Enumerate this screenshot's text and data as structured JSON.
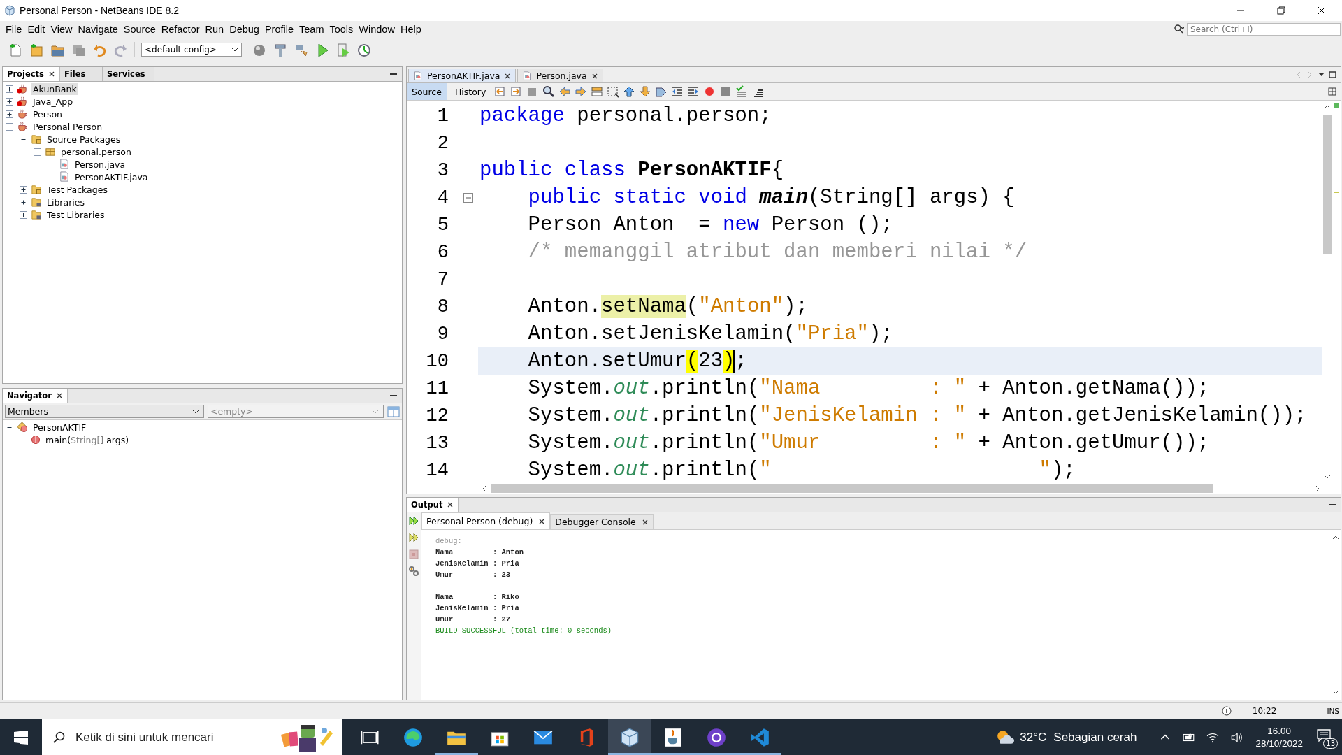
{
  "window": {
    "title": "Personal Person - NetBeans IDE 8.2"
  },
  "menu": [
    "File",
    "Edit",
    "View",
    "Navigate",
    "Source",
    "Refactor",
    "Run",
    "Debug",
    "Profile",
    "Team",
    "Tools",
    "Window",
    "Help"
  ],
  "toolbar": {
    "config": "<default config>"
  },
  "search": {
    "placeholder": "Search (Ctrl+I)"
  },
  "projects": {
    "tabs": [
      {
        "label": "Projects",
        "selected": true
      },
      {
        "label": "Files",
        "selected": false
      },
      {
        "label": "Services",
        "selected": false
      }
    ],
    "tree": [
      {
        "label": "AkunBank",
        "kind": "project_error",
        "selected": true,
        "expanded": false
      },
      {
        "label": "Java_App",
        "kind": "project_error",
        "selected": false,
        "expanded": false
      },
      {
        "label": "Person",
        "kind": "project",
        "selected": false,
        "expanded": false
      },
      {
        "label": "Personal Person",
        "kind": "project",
        "selected": false,
        "expanded": true,
        "children": [
          {
            "label": "Source Packages",
            "kind": "sources",
            "selected": false,
            "expanded": true,
            "children": [
              {
                "label": "personal.person",
                "kind": "package",
                "selected": false,
                "expanded": true,
                "children": [
                  {
                    "label": "Person.java",
                    "kind": "file",
                    "selected": false
                  },
                  {
                    "label": "PersonAKTIF.java",
                    "kind": "file",
                    "selected": false
                  }
                ]
              }
            ]
          },
          {
            "label": "Test Packages",
            "kind": "sources",
            "selected": false,
            "expanded": false
          },
          {
            "label": "Libraries",
            "kind": "library",
            "selected": false,
            "expanded": false
          },
          {
            "label": "Test Libraries",
            "kind": "library",
            "selected": false,
            "expanded": false
          }
        ]
      }
    ]
  },
  "navigator": {
    "tabs": [
      {
        "label": "Navigator",
        "selected": true
      }
    ],
    "filter": "Members",
    "scope": "<empty>",
    "class": {
      "label": "PersonAKTIF",
      "expanded": true
    },
    "members": [
      {
        "parts": [
          {
            "text": "main(",
            "kind": "name"
          },
          {
            "text": "String[]",
            "kind": "type"
          },
          {
            "text": " args)",
            "kind": "name"
          }
        ]
      }
    ]
  },
  "editor": {
    "tabs": [
      {
        "label": "PersonAKTIF.java",
        "selected": true
      },
      {
        "label": "Person.java",
        "selected": false
      }
    ],
    "views": [
      {
        "label": "Source",
        "selected": true
      },
      {
        "label": "History",
        "selected": false
      }
    ],
    "lines": [
      {
        "number": "1",
        "current": false,
        "fold": false,
        "tokens": [
          {
            "text": "package",
            "kind": "keyword"
          },
          {
            "text": " personal.person;",
            "kind": "plain"
          }
        ]
      },
      {
        "number": "2"
      },
      {
        "number": "3",
        "current": false,
        "fold": false,
        "tokens": [
          {
            "text": "public class",
            "kind": "keyword"
          },
          {
            "text": " PersonAKTIF",
            "kind": "classname"
          },
          {
            "text": "{",
            "kind": "plain"
          }
        ]
      },
      {
        "number": "4",
        "current": false,
        "fold": true,
        "tokens": [
          {
            "text": "    public static void",
            "kind": "keyword"
          },
          {
            "text": " main",
            "kind": "methoddecl"
          },
          {
            "text": "(String[] args) {",
            "kind": "plain"
          }
        ]
      },
      {
        "number": "5",
        "current": false,
        "fold": false,
        "tokens": [
          {
            "text": "    Person Anton  = ",
            "kind": "plain"
          },
          {
            "text": "new",
            "kind": "keyword"
          },
          {
            "text": " Person ();",
            "kind": "plain"
          }
        ]
      },
      {
        "number": "6",
        "current": false,
        "fold": false,
        "tokens": [
          {
            "text": "    /* memanggil atribut dan memberi nilai */",
            "kind": "comment"
          }
        ]
      },
      {
        "number": "7"
      },
      {
        "number": "8",
        "current": false,
        "fold": false,
        "tokens": [
          {
            "text": "    Anton.",
            "kind": "plain"
          },
          {
            "text": "setNama",
            "kind": "occurrence"
          },
          {
            "text": "(",
            "kind": "plain"
          },
          {
            "text": "\"Anton\"",
            "kind": "string"
          },
          {
            "text": ");",
            "kind": "plain"
          }
        ]
      },
      {
        "number": "9",
        "current": false,
        "fold": false,
        "tokens": [
          {
            "text": "    Anton.setJenisKelamin(",
            "kind": "plain"
          },
          {
            "text": "\"Pria\"",
            "kind": "string"
          },
          {
            "text": ");",
            "kind": "plain"
          }
        ]
      },
      {
        "number": "10",
        "current": true,
        "fold": false,
        "tokens": [
          {
            "text": "    Anton.setUmur",
            "kind": "plain"
          },
          {
            "text": "(",
            "kind": "bracket"
          },
          {
            "text": "23",
            "kind": "plain"
          },
          {
            "text": ")",
            "kind": "bracket",
            "caret": true
          },
          {
            "text": ";",
            "kind": "plain"
          }
        ]
      },
      {
        "number": "11",
        "current": false,
        "fold": false,
        "tokens": [
          {
            "text": "    System.",
            "kind": "plain"
          },
          {
            "text": "out",
            "kind": "field"
          },
          {
            "text": ".println(",
            "kind": "plain"
          },
          {
            "text": "\"Nama         : \"",
            "kind": "string"
          },
          {
            "text": " + Anton.getNama());",
            "kind": "plain"
          }
        ]
      },
      {
        "number": "12",
        "current": false,
        "fold": false,
        "tokens": [
          {
            "text": "    System.",
            "kind": "plain"
          },
          {
            "text": "out",
            "kind": "field"
          },
          {
            "text": ".println(",
            "kind": "plain"
          },
          {
            "text": "\"JenisKelamin : \"",
            "kind": "string"
          },
          {
            "text": " + Anton.getJenisKelamin());",
            "kind": "plain"
          }
        ]
      },
      {
        "number": "13",
        "current": false,
        "fold": false,
        "tokens": [
          {
            "text": "    System.",
            "kind": "plain"
          },
          {
            "text": "out",
            "kind": "field"
          },
          {
            "text": ".println(",
            "kind": "plain"
          },
          {
            "text": "\"Umur         : \"",
            "kind": "string"
          },
          {
            "text": " + Anton.getUmur());",
            "kind": "plain"
          }
        ]
      },
      {
        "number": "14",
        "current": false,
        "fold": false,
        "tokens": [
          {
            "text": "    System.",
            "kind": "plain"
          },
          {
            "text": "out",
            "kind": "field"
          },
          {
            "text": ".println(",
            "kind": "plain"
          },
          {
            "text": "\"                      \"",
            "kind": "string"
          },
          {
            "text": ");",
            "kind": "plain"
          }
        ]
      }
    ]
  },
  "output": {
    "tabs": [
      {
        "label": "Output",
        "selected": true
      }
    ],
    "subtabs": [
      {
        "label": "Personal Person (debug)",
        "selected": true
      },
      {
        "label": "Debugger Console",
        "selected": false
      }
    ],
    "blocks": [
      {
        "lines": [
          {
            "text": "debug:",
            "kind": "info"
          },
          {
            "text": "Nama         : Anton",
            "kind": "normal"
          },
          {
            "text": "JenisKelamin : Pria",
            "kind": "normal"
          },
          {
            "text": "Umur         : 23",
            "kind": "normal"
          }
        ]
      },
      {
        "lines": [
          {
            "text": "Nama         : Riko",
            "kind": "normal"
          },
          {
            "text": "JenisKelamin : Pria",
            "kind": "normal"
          },
          {
            "text": "Umur         : 27",
            "kind": "normal"
          },
          {
            "text": "BUILD SUCCESSFUL (total time: 0 seconds)",
            "kind": "success"
          }
        ]
      }
    ]
  },
  "status_bar": {
    "position": "10:22",
    "mode": "INS"
  },
  "taskbar": {
    "search_placeholder": "Ketik di sini untuk mencari",
    "apps": [
      {
        "kind": "taskview",
        "selected": false,
        "running": false
      },
      {
        "kind": "edge",
        "selected": false,
        "running": false
      },
      {
        "kind": "explorer",
        "selected": false,
        "running": true
      },
      {
        "kind": "store",
        "selected": false,
        "running": false
      },
      {
        "kind": "mail",
        "selected": false,
        "running": false
      },
      {
        "kind": "office",
        "selected": false,
        "running": false
      },
      {
        "kind": "netbeans",
        "selected": true,
        "running": true
      },
      {
        "kind": "java",
        "selected": false,
        "running": true
      },
      {
        "kind": "github",
        "selected": false,
        "running": true
      },
      {
        "kind": "vscode",
        "selected": false,
        "running": true
      }
    ],
    "weather": {
      "temp": "32°C",
      "text": "Sebagian cerah"
    },
    "time": "16.00",
    "date": "28/10/2022",
    "notifications": "13"
  }
}
